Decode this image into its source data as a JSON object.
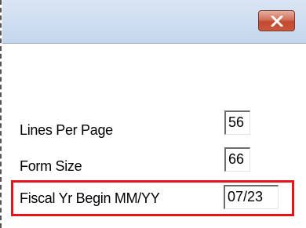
{
  "window": {
    "close_glyph": "close-icon"
  },
  "form": {
    "rows": [
      {
        "label": "Lines Per Page",
        "value": "56"
      },
      {
        "label": "Form Size",
        "value": "66"
      },
      {
        "label": "Fiscal  Yr Begin MM/YY",
        "value": "07/23"
      }
    ]
  },
  "colors": {
    "highlight_border": "#e8141c",
    "close_button": "#c9583c",
    "titlebar": "#c4d6ec"
  }
}
